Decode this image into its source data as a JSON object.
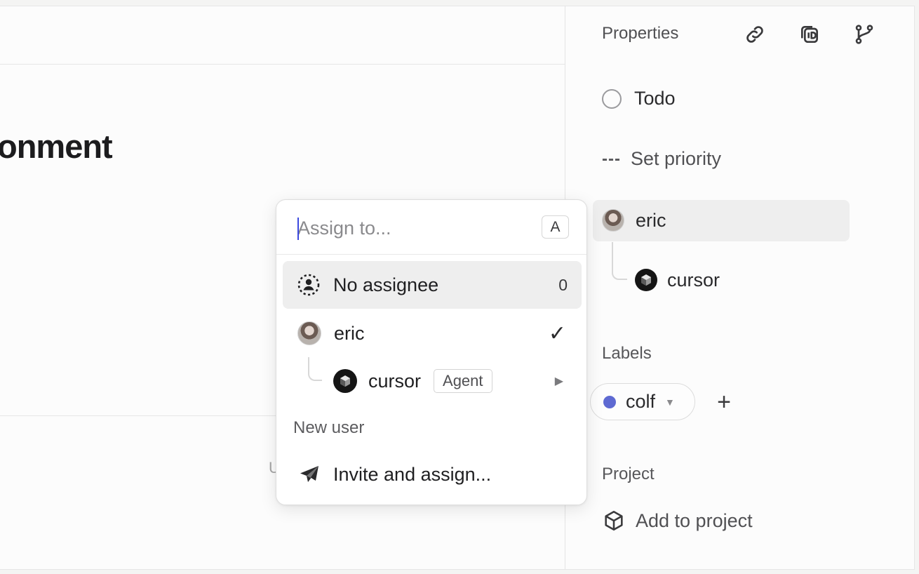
{
  "issue": {
    "title_fragment": "onment",
    "bottom_hint": "U"
  },
  "properties": {
    "title": "Properties",
    "header_icons": [
      "link-icon",
      "copy-id-icon",
      "git-branch-icon"
    ],
    "status": {
      "label": "Todo",
      "icon": "status-circle-icon"
    },
    "priority": {
      "label": "Set priority",
      "icon": "---"
    },
    "assignee": {
      "name": "eric"
    },
    "delegate": {
      "name": "cursor"
    },
    "labels_title": "Labels",
    "labels": [
      {
        "name": "colf",
        "color": "#5e6ad2"
      }
    ],
    "add_label": "+",
    "project_title": "Project",
    "add_to_project": "Add to project"
  },
  "assign_dropdown": {
    "placeholder": "Assign to...",
    "shortcut": "A",
    "no_assignee": {
      "label": "No assignee",
      "count": "0"
    },
    "users": [
      {
        "name": "eric",
        "selected": true,
        "check": "✓"
      }
    ],
    "agents": [
      {
        "name": "cursor",
        "badge": "Agent",
        "arrow": "▶"
      }
    ],
    "new_user_section": "New user",
    "invite": "Invite and assign..."
  }
}
